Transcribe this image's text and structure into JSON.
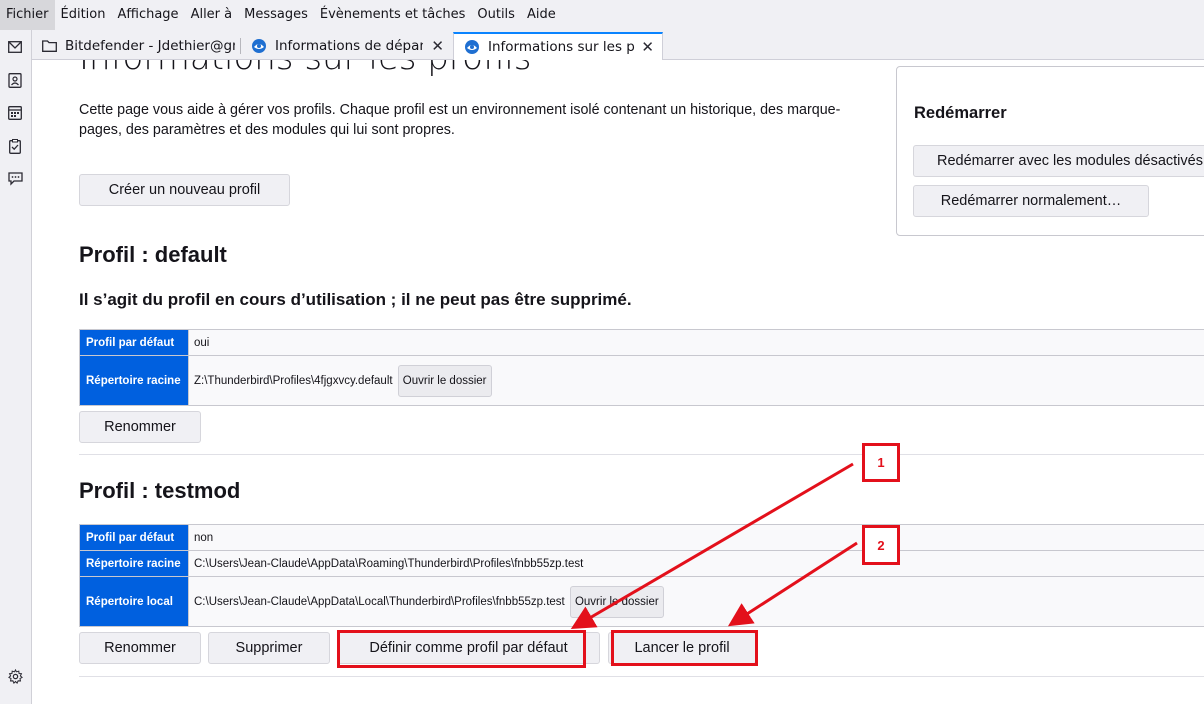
{
  "menubar": {
    "items": [
      "Fichier",
      "Édition",
      "Affichage",
      "Aller à",
      "Messages",
      "Évènements et tâches",
      "Outils",
      "Aide"
    ]
  },
  "tabs": [
    {
      "label": "Bitdefender - Jdethier@gm",
      "icon": "folder-icon"
    },
    {
      "label": "Informations de dépanna",
      "icon": "thunderbird-icon"
    },
    {
      "label": "Informations sur les prof",
      "icon": "thunderbird-icon"
    }
  ],
  "page": {
    "title": "Informations sur les profils",
    "intro": "Cette page vous aide à gérer vos profils. Chaque profil est un environnement isolé contenant un historique, des marque-pages, des paramètres et des modules qui lui sont propres.",
    "create_button": "Créer un nouveau profil"
  },
  "restart": {
    "title": "Redémarrer",
    "safe_mode_button": "Redémarrer avec les modules désactivés…",
    "normal_button": "Redémarrer normalement…"
  },
  "profile_default": {
    "heading": "Profil : default",
    "current_notice": "Il s’agit du profil en cours d’utilisation ; il ne peut pas être supprimé.",
    "rows": {
      "default_label": "Profil par défaut",
      "default_value": "oui",
      "root_label": "Répertoire racine",
      "root_value": "Z:\\Thunderbird\\Profiles\\4fjgxvcy.default",
      "open_folder": "Ouvrir le dossier"
    },
    "rename_button": "Renommer"
  },
  "profile_testmod": {
    "heading": "Profil : testmod",
    "rows": {
      "default_label": "Profil par défaut",
      "default_value": "non",
      "root_label": "Répertoire racine",
      "root_value": "C:\\Users\\Jean-Claude\\AppData\\Roaming\\Thunderbird\\Profiles\\fnbb55zp.test",
      "local_label": "Répertoire local",
      "local_value": "C:\\Users\\Jean-Claude\\AppData\\Local\\Thunderbird\\Profiles\\fnbb55zp.test",
      "open_folder": "Ouvrir le dossier"
    },
    "rename_button": "Renommer",
    "delete_button": "Supprimer",
    "set_default_button": "Définir comme profil par défaut",
    "launch_button": "Lancer le profil"
  },
  "annotations": {
    "label_1": "1",
    "label_2": "2",
    "color": "#e3101b"
  },
  "colors": {
    "accent": "#0060df",
    "tab_highlight": "#0a84ff"
  }
}
